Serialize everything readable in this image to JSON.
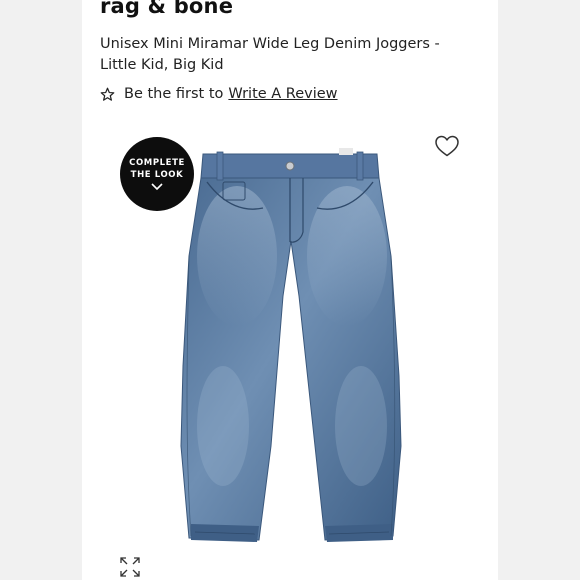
{
  "product": {
    "brand": "rag & bone",
    "title": "Unisex Mini Miramar Wide Leg Denim Joggers - Little Kid, Big Kid"
  },
  "review": {
    "prompt": "Be the first to",
    "link_label": "Write A Review"
  },
  "complete_look": {
    "line1": "COMPLETE",
    "line2": "THE LOOK"
  },
  "icons": {
    "star": "star-outline-icon",
    "heart": "heart-outline-icon",
    "chevron": "chevron-down-icon",
    "expand": "expand-arrows-icon"
  },
  "colors": {
    "background": "#f1f1f1",
    "panel": "#ffffff",
    "text": "#222222",
    "badge": "#0d0d0d",
    "denim": "#4f6f93"
  }
}
